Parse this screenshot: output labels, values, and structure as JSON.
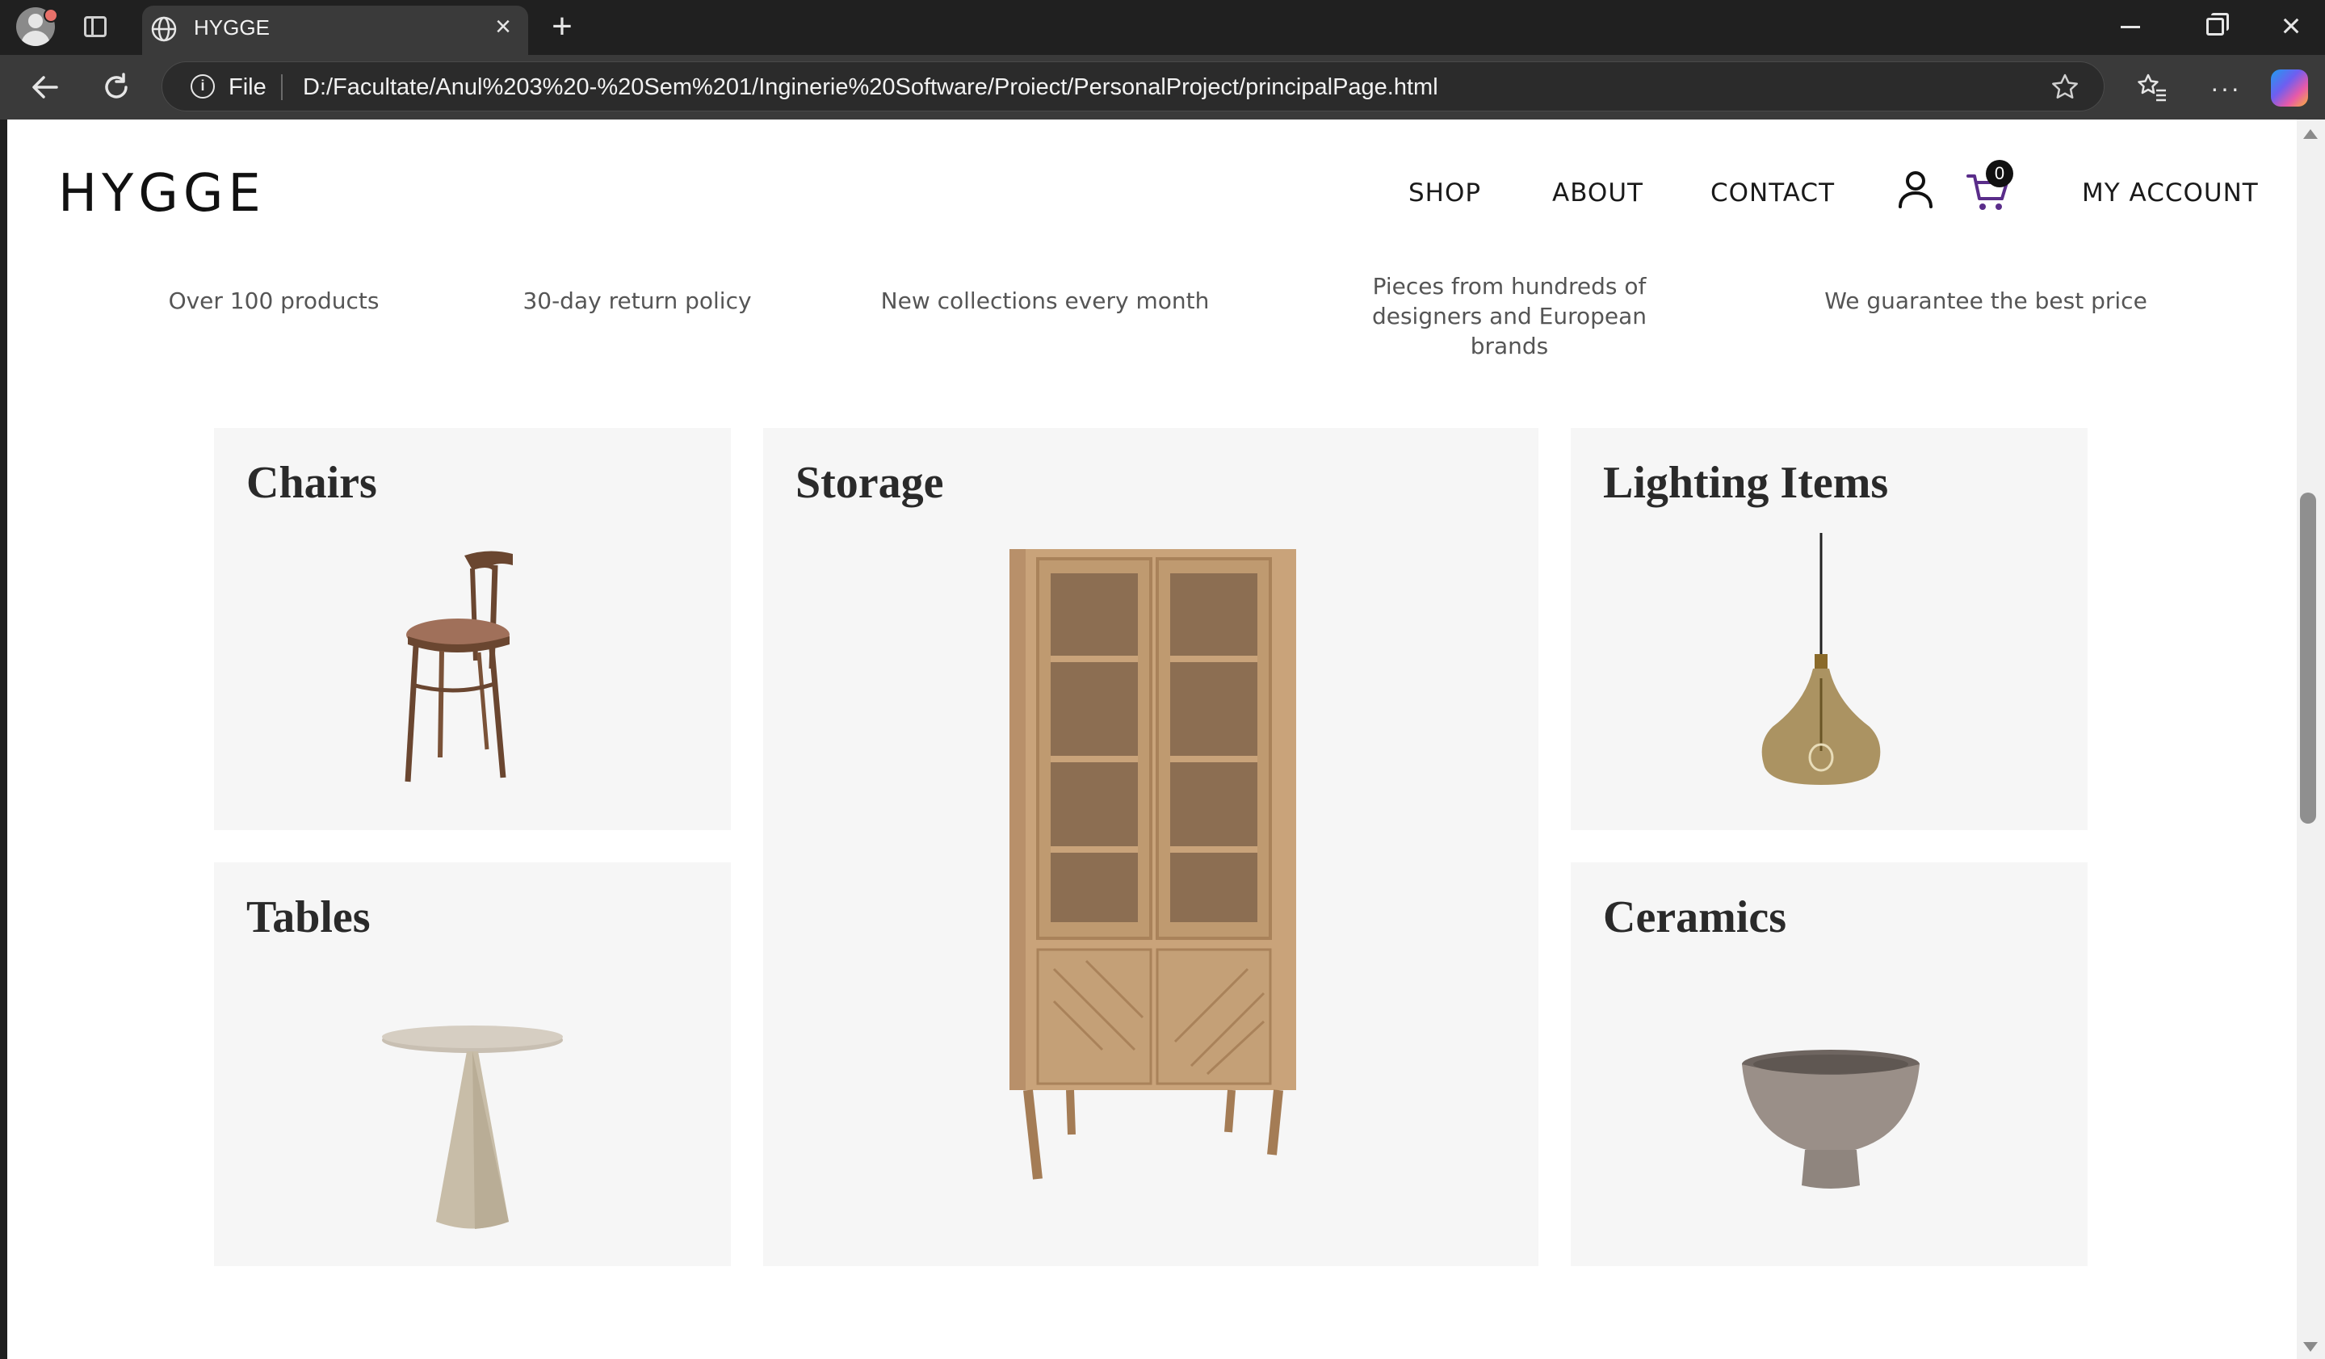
{
  "browser": {
    "tab_title": "HYGGE",
    "address_prefix": "File",
    "url": "D:/Facultate/Anul%203%20-%20Sem%201/Inginerie%20Software/Proiect/PersonalProject/principalPage.html"
  },
  "site": {
    "logo": "HYGGE",
    "nav": [
      "SHOP",
      "ABOUT",
      "CONTACT"
    ],
    "account_label": "MY ACCOUNT",
    "cart_count": "0"
  },
  "features": [
    "Over 100 products",
    "30-day return policy",
    "New collections every month",
    "Pieces from hundreds of designers and European brands",
    "We guarantee the best price"
  ],
  "categories": {
    "chairs": "Chairs",
    "storage": "Storage",
    "lighting": "Lighting Items",
    "tables": "Tables",
    "ceramics": "Ceramics"
  },
  "colors": {
    "card_background": "#f6f6f6",
    "cart_icon": "#5a2d8a"
  }
}
